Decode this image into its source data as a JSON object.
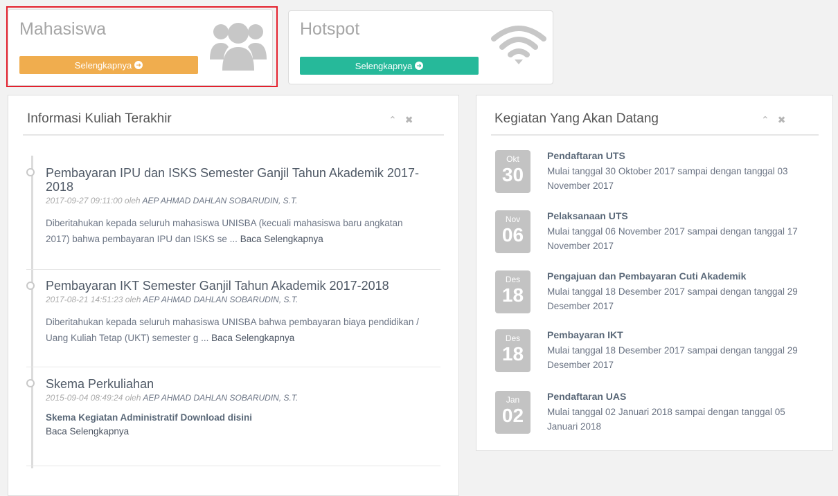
{
  "tiles": [
    {
      "title": "Mahasiswa",
      "button_label": "Selengkapnya",
      "button_color": "#f0ad4e",
      "icon": "users-icon"
    },
    {
      "title": "Hotspot",
      "button_label": "Selengkapnya",
      "button_color": "#26b99a",
      "icon": "wifi-icon"
    }
  ],
  "info_panel": {
    "title": "Informasi Kuliah Terakhir",
    "items": [
      {
        "title": "Pembayaran IPU dan ISKS Semester Ganjil Tahun Akademik 2017-2018",
        "timestamp": "2017-09-27 09:11:00",
        "by": "oleh",
        "author": "AEP AHMAD DAHLAN SOBARUDIN, S.T.",
        "excerpt": "Diberitahukan kepada seluruh mahasiswa UNISBA (kecuali mahasiswa baru angkatan 2017) bahwa pembayaran IPU dan ISKS se ...",
        "more": "Baca Selengkapnya"
      },
      {
        "title": "Pembayaran IKT Semester Ganjil Tahun Akademik 2017-2018",
        "timestamp": "2017-08-21 14:51:23",
        "by": "oleh",
        "author": "AEP AHMAD DAHLAN SOBARUDIN, S.T.",
        "excerpt": "Diberitahukan kepada seluruh mahasiswa UNISBA bahwa pembayaran biaya pendidikan / Uang Kuliah Tetap (UKT) semester g ...",
        "more": "Baca Selengkapnya"
      },
      {
        "title": "Skema Perkuliahan",
        "timestamp": "2015-09-04 08:49:24",
        "by": "oleh",
        "author": "AEP AHMAD DAHLAN SOBARUDIN, S.T.",
        "bold_line": "Skema Kegiatan Administratif Download disini",
        "more": "Baca Selengkapnya"
      }
    ]
  },
  "events_panel": {
    "title": "Kegiatan Yang Akan Datang",
    "events": [
      {
        "month": "Okt",
        "day": "30",
        "title": "Pendaftaran UTS",
        "desc": "Mulai tanggal 30 Oktober 2017 sampai dengan tanggal 03 November 2017"
      },
      {
        "month": "Nov",
        "day": "06",
        "title": "Pelaksanaan UTS",
        "desc": "Mulai tanggal 06 November 2017 sampai dengan tanggal 17 November 2017"
      },
      {
        "month": "Des",
        "day": "18",
        "title": "Pengajuan dan Pembayaran Cuti Akademik",
        "desc": "Mulai tanggal 18 Desember 2017 sampai dengan tanggal 29 Desember 2017"
      },
      {
        "month": "Des",
        "day": "18",
        "title": "Pembayaran IKT",
        "desc": "Mulai tanggal 18 Desember 2017 sampai dengan tanggal 29 Desember 2017"
      },
      {
        "month": "Jan",
        "day": "02",
        "title": "Pendaftaran UAS",
        "desc": "Mulai tanggal 02 Januari 2018 sampai dengan tanggal 05 Januari 2018"
      }
    ]
  }
}
